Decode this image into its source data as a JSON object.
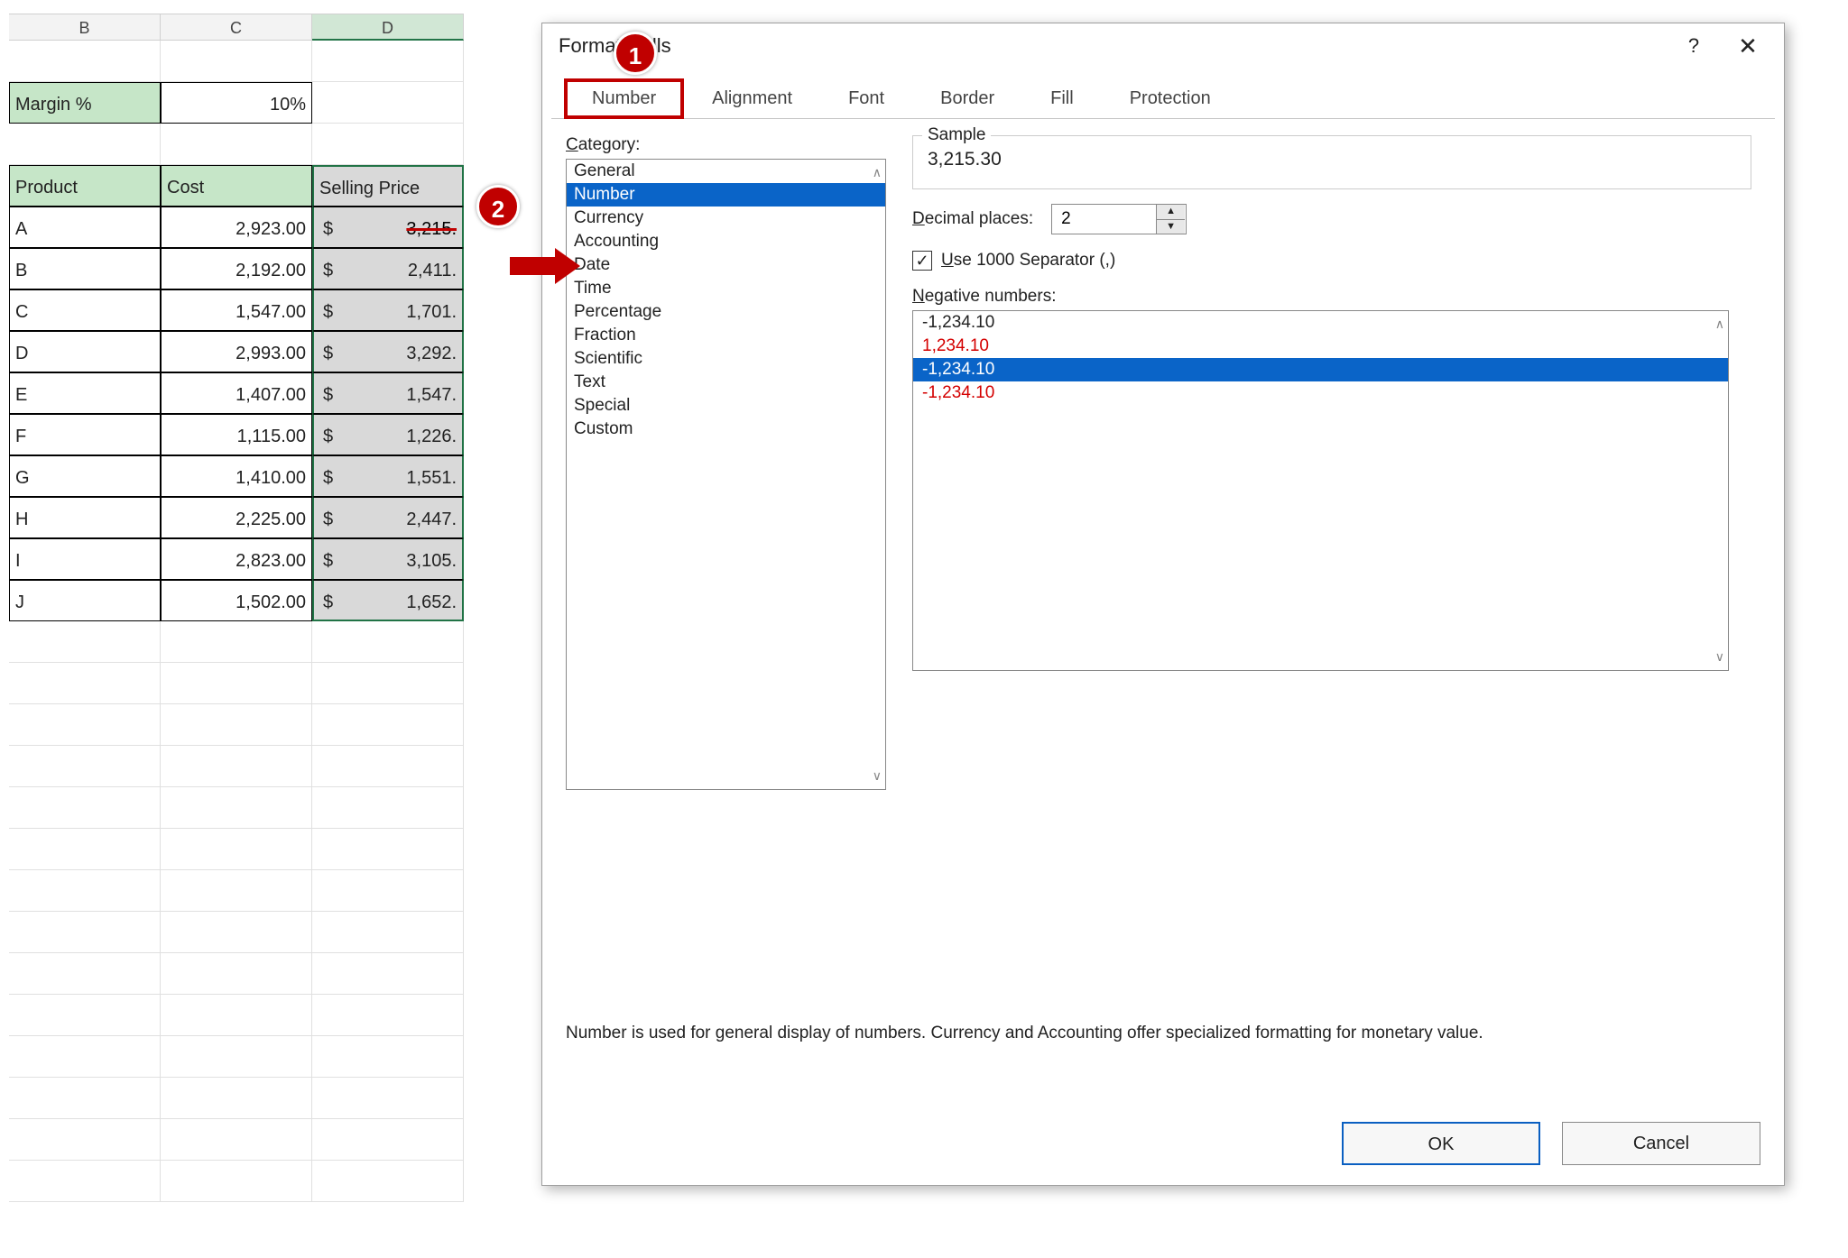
{
  "columns": [
    "B",
    "C",
    "D"
  ],
  "selected_col_index": 2,
  "margin": {
    "label": "Margin %",
    "value": "10%"
  },
  "table": {
    "headers": [
      "Product",
      "Cost",
      "Selling Price"
    ],
    "rows": [
      {
        "p": "A",
        "cost": "2,923.00",
        "sell": "3,215."
      },
      {
        "p": "B",
        "cost": "2,192.00",
        "sell": "2,411."
      },
      {
        "p": "C",
        "cost": "1,547.00",
        "sell": "1,701."
      },
      {
        "p": "D",
        "cost": "2,993.00",
        "sell": "3,292."
      },
      {
        "p": "E",
        "cost": "1,407.00",
        "sell": "1,547."
      },
      {
        "p": "F",
        "cost": "1,115.00",
        "sell": "1,226."
      },
      {
        "p": "G",
        "cost": "1,410.00",
        "sell": "1,551."
      },
      {
        "p": "H",
        "cost": "2,225.00",
        "sell": "2,447."
      },
      {
        "p": "I",
        "cost": "2,823.00",
        "sell": "3,105."
      },
      {
        "p": "J",
        "cost": "1,502.00",
        "sell": "1,652."
      }
    ],
    "currency_symbol": "$"
  },
  "dialog": {
    "title": "Format Cells",
    "help": "?",
    "close": "✕",
    "tabs": [
      "Number",
      "Alignment",
      "Font",
      "Border",
      "Fill",
      "Protection"
    ],
    "category_label": "Category:",
    "categories": [
      "General",
      "Number",
      "Currency",
      "Accounting",
      "Date",
      "Time",
      "Percentage",
      "Fraction",
      "Scientific",
      "Text",
      "Special",
      "Custom"
    ],
    "selected_category_index": 1,
    "sample": {
      "label": "Sample",
      "value": "3,215.30"
    },
    "decimal": {
      "label": "Decimal places:",
      "value": "2"
    },
    "separator": {
      "label": "Use 1000 Separator (,)",
      "checked": true,
      "checkmark": "✓"
    },
    "negative_label": "Negative numbers:",
    "negatives": [
      {
        "text": "-1,234.10",
        "red": false
      },
      {
        "text": "1,234.10",
        "red": true
      },
      {
        "text": "-1,234.10",
        "red": false,
        "selected": true
      },
      {
        "text": "-1,234.10",
        "red": true
      }
    ],
    "description": "Number is used for general display of numbers.  Currency and Accounting offer specialized formatting for monetary value.",
    "ok": "OK",
    "cancel": "Cancel"
  },
  "callouts": {
    "one": "1",
    "two": "2"
  }
}
